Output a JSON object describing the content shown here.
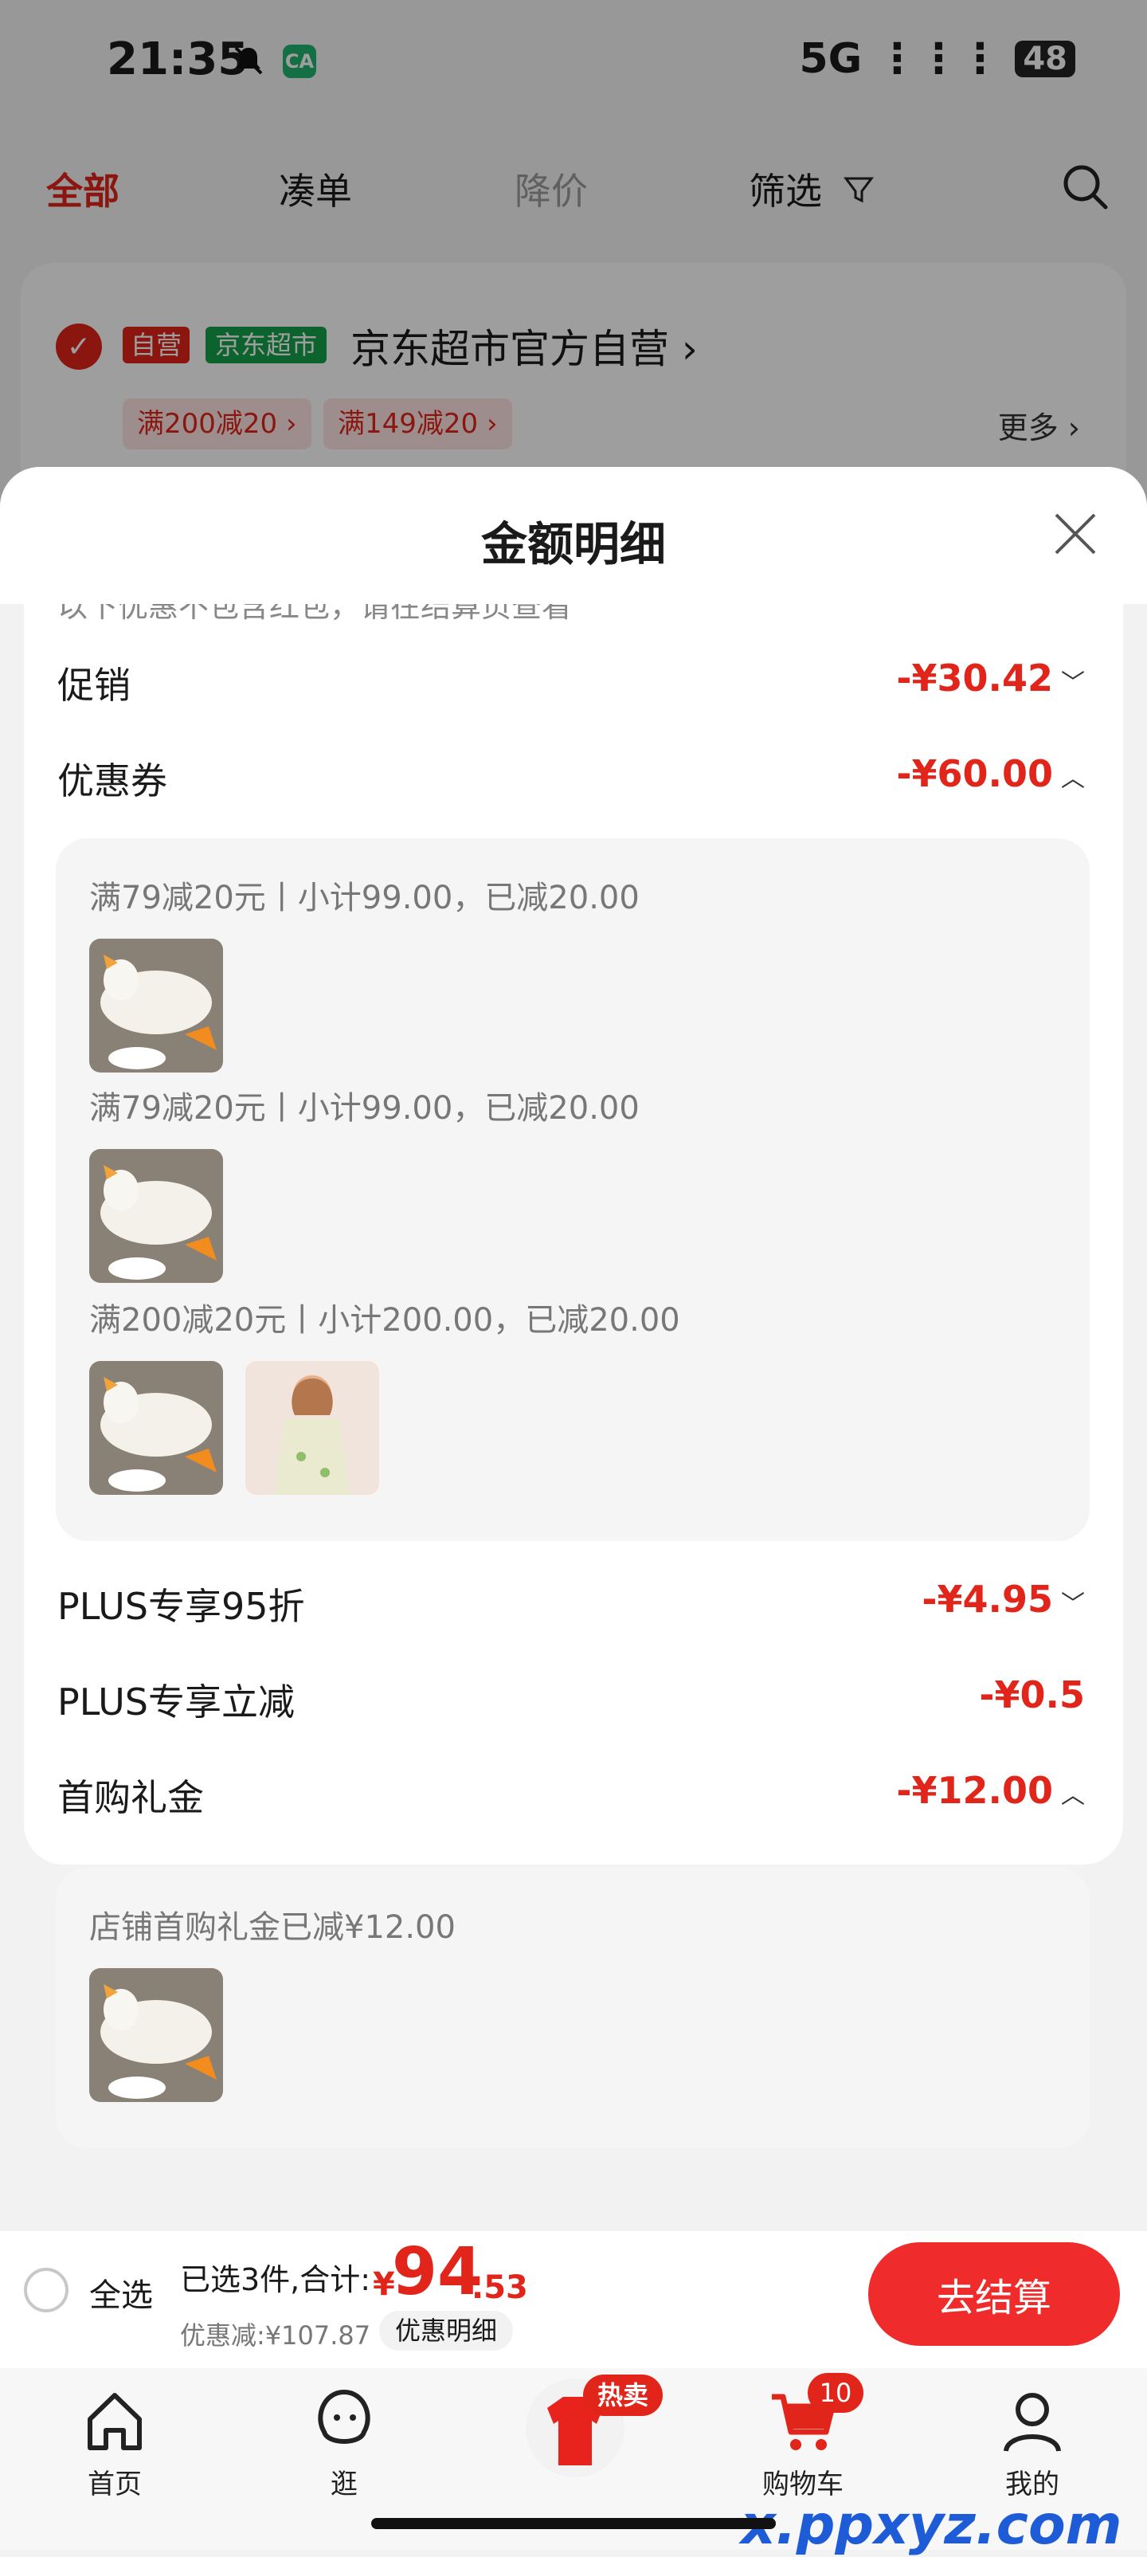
{
  "status_bar": {
    "time": "21:35",
    "network": "5G",
    "battery": "48"
  },
  "tabs": [
    {
      "label": "全部",
      "state": "active"
    },
    {
      "label": "凑单",
      "state": "normal"
    },
    {
      "label": "降价",
      "state": "dim"
    },
    {
      "label": "筛选",
      "state": "normal"
    }
  ],
  "shop": {
    "tag_self": "自营",
    "tag_super": "京东超市",
    "name": "京东超市官方自营",
    "coupons": [
      "满200减20",
      "满149减20"
    ],
    "more": "更多"
  },
  "sheet": {
    "title": "金额明细",
    "notice": "以下优惠不包含红包，请在结算页查看",
    "rows": {
      "promo": {
        "label": "促销",
        "value": "-¥30.42"
      },
      "coupon": {
        "label": "优惠券",
        "value": "-¥60.00"
      },
      "plus_discount": {
        "label": "PLUS专享95折",
        "value": "-¥4.95"
      },
      "plus_instant": {
        "label": "PLUS专享立减",
        "value": "-¥0.5"
      },
      "first_gift": {
        "label": "首购礼金",
        "value": "-¥12.00"
      }
    },
    "coupon_details": [
      "满79减20元丨小计99.00，已减20.00",
      "满79减20元丨小计99.00，已减20.00",
      "满200减20元丨小计200.00，已减20.00"
    ],
    "gift_detail": "店铺首购礼金已减¥12.00"
  },
  "checkout": {
    "select_all": "全选",
    "summary": "已选3件,合计:",
    "price_yen": "¥",
    "price_int": "94",
    "price_dec": ".53",
    "discount": "优惠减:¥107.87",
    "detail_button": "优惠明细",
    "checkout_button": "去结算"
  },
  "nav": {
    "home": "首页",
    "browse": "逛",
    "hot_badge": "热卖",
    "cart": "购物车",
    "cart_count": "10",
    "mine": "我的"
  },
  "watermark": "x.ppxyz.com",
  "colors": {
    "accent": "#e1251b",
    "green": "#16a04a"
  }
}
